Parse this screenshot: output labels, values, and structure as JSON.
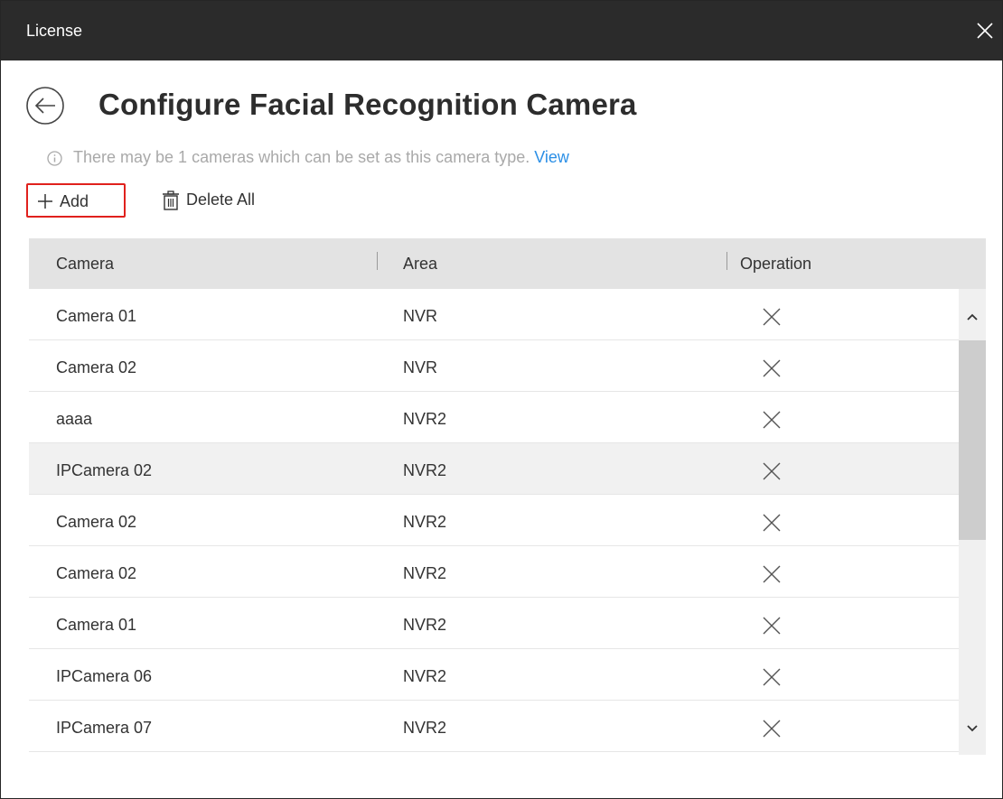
{
  "window": {
    "title": "License",
    "close_icon": "close-icon"
  },
  "header": {
    "back_icon": "back-arrow-icon",
    "title": "Configure Facial Recognition Camera"
  },
  "hint": {
    "icon": "info-icon",
    "text": "There may be 1 cameras which can be set as this camera type. ",
    "link_label": "View"
  },
  "toolbar": {
    "add_label": "Add",
    "add_icon": "plus-icon",
    "delete_all_label": "Delete All",
    "delete_all_icon": "trash-icon"
  },
  "table": {
    "columns": [
      "Camera",
      "Area",
      "Operation"
    ],
    "rows": [
      {
        "camera": "Camera 01",
        "area": "NVR"
      },
      {
        "camera": "Camera 02",
        "area": "NVR"
      },
      {
        "camera": "aaaa",
        "area": "NVR2"
      },
      {
        "camera": "IPCamera 02",
        "area": "NVR2"
      },
      {
        "camera": "Camera 02",
        "area": "NVR2"
      },
      {
        "camera": "Camera 02",
        "area": "NVR2"
      },
      {
        "camera": "Camera 01",
        "area": "NVR2"
      },
      {
        "camera": "IPCamera 06",
        "area": "NVR2"
      },
      {
        "camera": "IPCamera 07",
        "area": "NVR2"
      }
    ],
    "hovered_row_index": 3,
    "operation_icon": "delete-x-icon"
  },
  "scrollbar": {
    "position_fraction": 0.0,
    "visible_fraction": 0.55
  },
  "colors": {
    "titlebar": "#2b2b2b",
    "link": "#2b8fe6",
    "highlight_border": "#e0211d",
    "header_bg": "#e3e3e3",
    "hover_row": "#f1f1f1"
  }
}
